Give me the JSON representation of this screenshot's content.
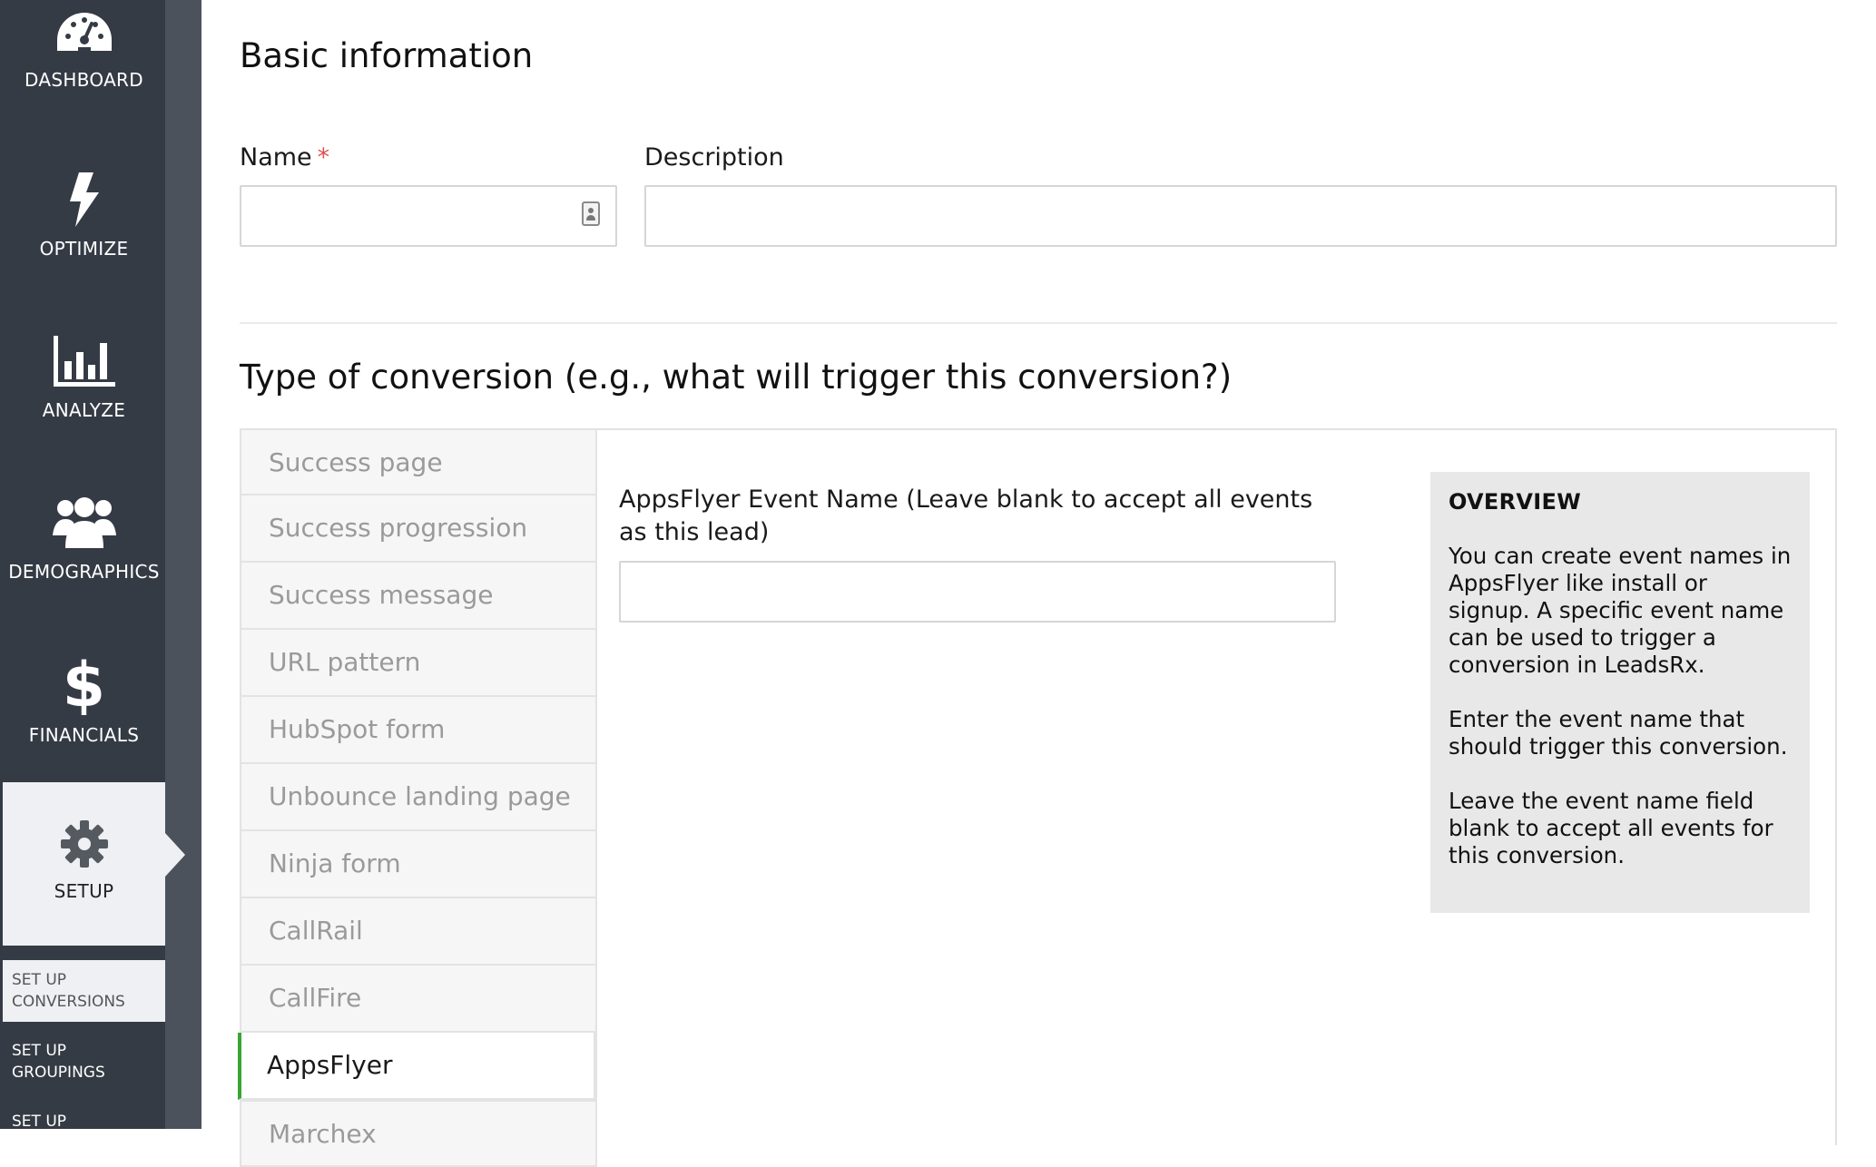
{
  "sidebar": {
    "items": [
      {
        "label": "DASHBOARD",
        "icon": "dashboard-gauge-icon"
      },
      {
        "label": "OPTIMIZE",
        "icon": "lightning-bolt-icon"
      },
      {
        "label": "ANALYZE",
        "icon": "bar-chart-icon"
      },
      {
        "label": "DEMOGRAPHICS",
        "icon": "people-group-icon"
      },
      {
        "label": "FINANCIALS",
        "icon": "dollar-sign-icon"
      },
      {
        "label": "SETUP",
        "icon": "gear-icon",
        "active": true
      }
    ],
    "subitems": [
      {
        "line1": "SET UP",
        "line2": "CONVERSIONS",
        "active": true
      },
      {
        "line1": "SET UP",
        "line2": "GROUPINGS"
      },
      {
        "line1": "SET UP",
        "line2": ""
      }
    ]
  },
  "basic": {
    "heading": "Basic information",
    "name_label": "Name",
    "required_mark": "*",
    "name_value": "",
    "description_label": "Description",
    "description_value": ""
  },
  "conversion": {
    "heading": "Type of conversion (e.g., what will trigger this conversion?)",
    "tabs": [
      "Success page",
      "Success progression",
      "Success message",
      "URL pattern",
      "HubSpot form",
      "Unbounce landing page",
      "Ninja form",
      "CallRail",
      "CallFire",
      "AppsFlyer",
      "Marchex"
    ],
    "active_tab": "AppsFlyer",
    "event_name_label": "AppsFlyer Event Name (Leave blank to accept all events as this lead)",
    "event_name_value": "",
    "overview": {
      "title": "OVERVIEW",
      "paragraphs": [
        "You can create event names in AppsFlyer like install or signup. A specific event name can be used to trigger a conversion in LeadsRx.",
        "Enter the event name that should trigger this conversion.",
        "Leave the event name field blank to accept all events for this conversion."
      ]
    }
  },
  "colors": {
    "sidebar_bg": "#353b45",
    "active_tab_accent": "#3aa534",
    "required": "#d9534f"
  }
}
